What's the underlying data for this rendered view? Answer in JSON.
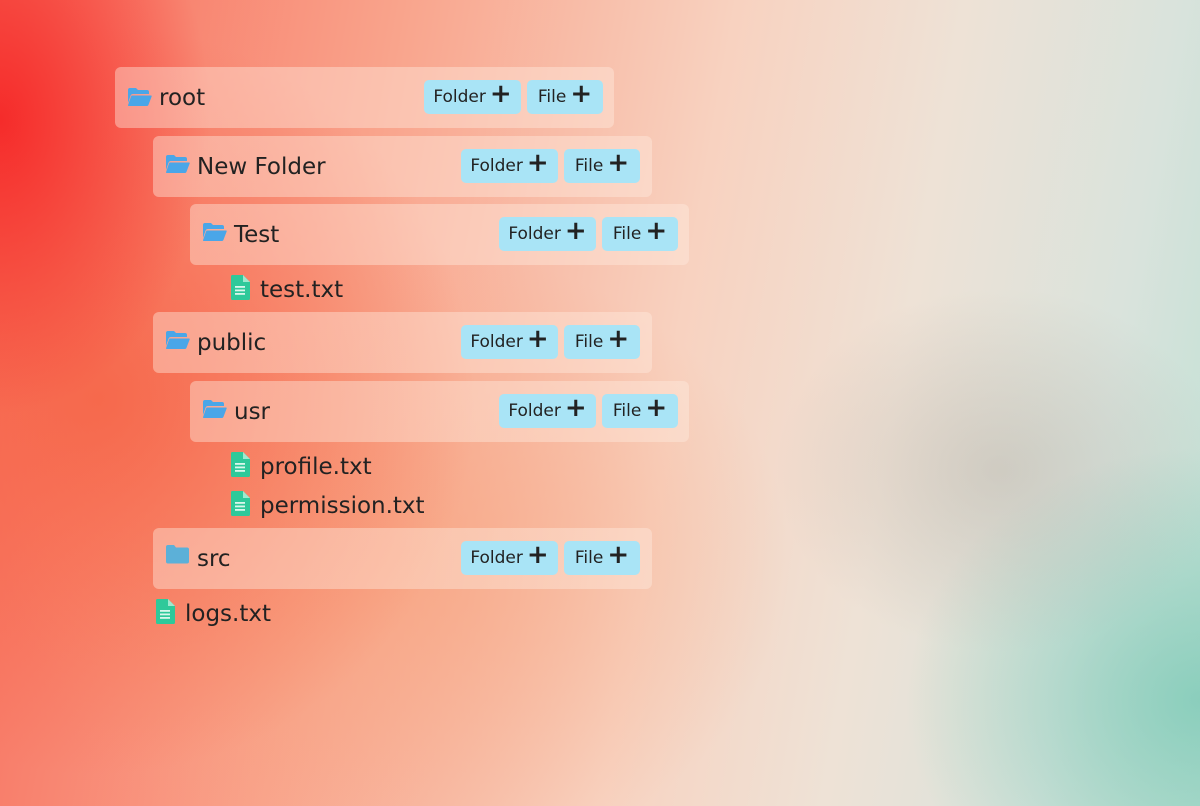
{
  "colors": {
    "folder_open_icon": "#4aa6e8",
    "folder_closed_icon": "#5cb0d8",
    "file_icon": "#2ec99a",
    "button_bg": "#a9e4f6"
  },
  "tree": {
    "root": {
      "name": "root",
      "folder_button": "Folder",
      "file_button": "File",
      "icon": "folder-open-icon"
    },
    "new_folder": {
      "name": "New Folder",
      "folder_button": "Folder",
      "file_button": "File",
      "icon": "folder-open-icon"
    },
    "test": {
      "name": "Test",
      "folder_button": "Folder",
      "file_button": "File",
      "icon": "folder-open-icon"
    },
    "test_txt": {
      "name": "test.txt",
      "icon": "file-text-icon"
    },
    "public": {
      "name": "public",
      "folder_button": "Folder",
      "file_button": "File",
      "icon": "folder-open-icon"
    },
    "usr": {
      "name": "usr",
      "folder_button": "Folder",
      "file_button": "File",
      "icon": "folder-open-icon"
    },
    "profile_txt": {
      "name": "profile.txt",
      "icon": "file-text-icon"
    },
    "permission_txt": {
      "name": "permission.txt",
      "icon": "file-text-icon"
    },
    "src": {
      "name": "src",
      "folder_button": "Folder",
      "file_button": "File",
      "icon": "folder-closed-icon"
    },
    "logs_txt": {
      "name": "logs.txt",
      "icon": "file-text-icon"
    }
  }
}
